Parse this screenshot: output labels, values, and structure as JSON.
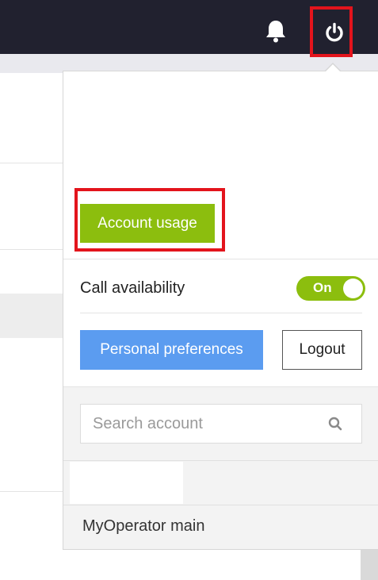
{
  "header": {
    "bell_icon": "bell-icon",
    "power_icon": "power-icon",
    "highlight_color": "#e3141c"
  },
  "menu": {
    "account_usage_label": "Account usage",
    "call_availability_label": "Call availability",
    "toggle_state": "On",
    "personal_preferences_label": "Personal preferences",
    "logout_label": "Logout",
    "search_placeholder": "Search account",
    "search_value": "",
    "accounts": [
      "MyOperator main"
    ]
  },
  "colors": {
    "topbar": "#21212f",
    "accent_green": "#8cbe0e",
    "accent_blue": "#5b9cf0"
  }
}
